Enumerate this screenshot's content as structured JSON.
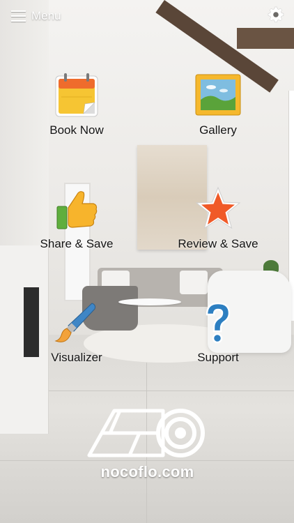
{
  "header": {
    "menu_label": "Menu",
    "menu_icon": "hamburger-icon",
    "settings_icon": "gear-icon"
  },
  "tiles": [
    {
      "label": "Book Now",
      "icon": "calendar-icon"
    },
    {
      "label": "Gallery",
      "icon": "picture-icon"
    },
    {
      "label": "Share & Save",
      "icon": "thumbs-up-icon"
    },
    {
      "label": "Review & Save",
      "icon": "star-icon"
    },
    {
      "label": "Visualizer",
      "icon": "paintbrush-icon"
    },
    {
      "label": "Support",
      "icon": "question-mark-icon"
    }
  ],
  "logo": {
    "text": "nocoflo.com",
    "icon": "flooring-roll-icon"
  },
  "colors": {
    "header_text": "#ffffff",
    "tile_label": "#141414",
    "calendar_top": "#ef6c2c",
    "calendar_body": "#f6c533",
    "star": "#f05a28",
    "question": "#2d7fc1",
    "thumb": "#f7b42c"
  }
}
